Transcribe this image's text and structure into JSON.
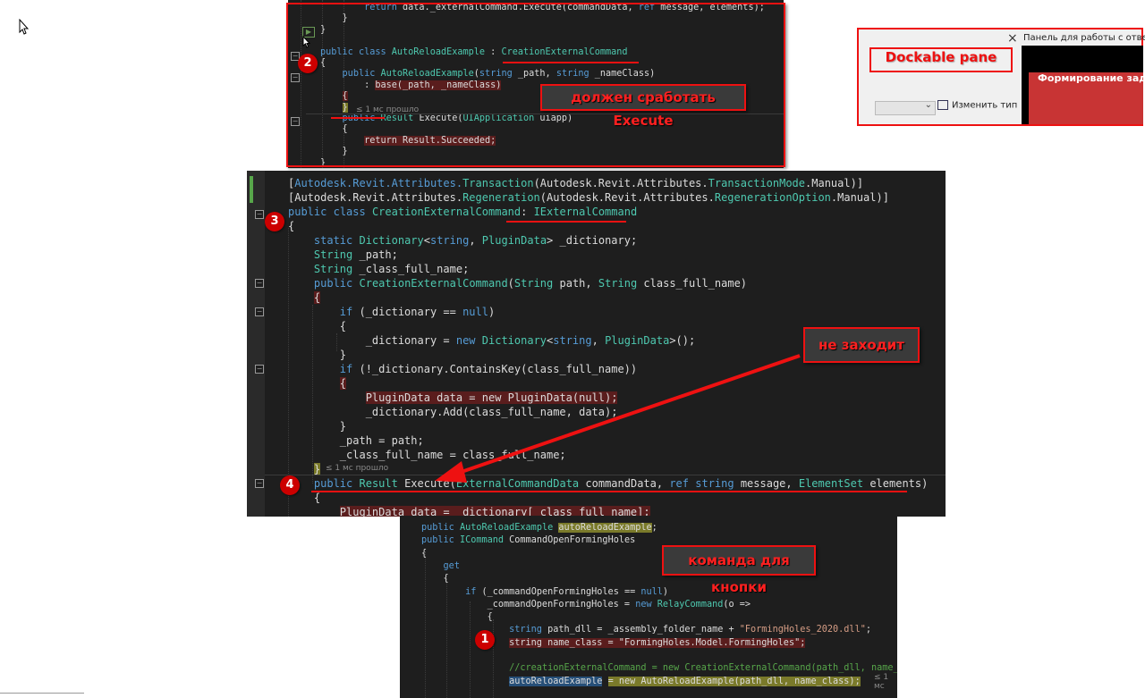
{
  "panel1": {
    "lines": [
      {
        "segs": [
          {
            "t": "        "
          },
          {
            "t": "return",
            "c": "kw"
          },
          {
            "t": " data._externalCommand.Execute(commandData, "
          },
          {
            "t": "ref",
            "c": "kw"
          },
          {
            "t": " message, elements);"
          }
        ]
      },
      {
        "segs": [
          {
            "t": "    }"
          }
        ]
      },
      {
        "segs": [
          {
            "t": "}"
          }
        ]
      },
      {
        "segs": [
          {
            "t": ""
          }
        ]
      },
      {
        "segs": [
          {
            "t": "public",
            "c": "kw"
          },
          {
            "t": " "
          },
          {
            "t": "class",
            "c": "kw"
          },
          {
            "t": " "
          },
          {
            "t": "AutoReloadExample",
            "c": "ty"
          },
          {
            "t": " : "
          },
          {
            "t": "CreationExternalCommand",
            "c": "ty"
          }
        ]
      },
      {
        "segs": [
          {
            "t": "{"
          }
        ]
      },
      {
        "segs": [
          {
            "t": "    "
          },
          {
            "t": "public",
            "c": "kw"
          },
          {
            "t": " "
          },
          {
            "t": "AutoReloadExample",
            "c": "ty"
          },
          {
            "t": "("
          },
          {
            "t": "string",
            "c": "kw"
          },
          {
            "t": " _path, "
          },
          {
            "t": "string",
            "c": "kw"
          },
          {
            "t": " _nameClass)"
          }
        ]
      },
      {
        "segs": [
          {
            "t": "        : "
          },
          {
            "t": "base(_path, _nameClass)",
            "c": "hl"
          }
        ]
      },
      {
        "segs": [
          {
            "t": "    "
          },
          {
            "t": "{",
            "c": "hl"
          }
        ]
      },
      {
        "segs": [
          {
            "t": "    "
          },
          {
            "t": "}",
            "c": "hly"
          }
        ]
      },
      {
        "segs": [
          {
            "t": "    "
          },
          {
            "t": "public",
            "c": "kw"
          },
          {
            "t": " "
          },
          {
            "t": "Result",
            "c": "ty"
          },
          {
            "t": " Execute("
          },
          {
            "t": "UIApplication",
            "c": "ty"
          },
          {
            "t": " uiapp)"
          }
        ]
      },
      {
        "segs": [
          {
            "t": "    {"
          }
        ]
      },
      {
        "segs": [
          {
            "t": "        "
          },
          {
            "t": "return Result.Succeeded;",
            "c": "hl"
          }
        ]
      },
      {
        "segs": [
          {
            "t": "    }"
          }
        ]
      },
      {
        "segs": [
          {
            "t": "}"
          }
        ]
      }
    ],
    "hint": "≤ 1 мс прошло"
  },
  "panel2": {
    "lines": [
      {
        "segs": [
          {
            "t": "["
          },
          {
            "t": "Autodesk.Revit.Attributes.",
            "c": "kw"
          },
          {
            "t": "Transaction",
            "c": "ty"
          },
          {
            "t": "(Autodesk.Revit.Attributes."
          },
          {
            "t": "TransactionMode",
            "c": "ty"
          },
          {
            "t": ".Manual)]"
          }
        ]
      },
      {
        "segs": [
          {
            "t": "[Autodesk.Revit.Attributes."
          },
          {
            "t": "Regeneration",
            "c": "ty"
          },
          {
            "t": "(Autodesk.Revit.Attributes."
          },
          {
            "t": "RegenerationOption",
            "c": "ty"
          },
          {
            "t": ".Manual)]"
          }
        ]
      },
      {
        "segs": [
          {
            "t": "public",
            "c": "kw"
          },
          {
            "t": " "
          },
          {
            "t": "class",
            "c": "kw"
          },
          {
            "t": " "
          },
          {
            "t": "CreationExternalCommand",
            "c": "ty"
          },
          {
            "t": ": "
          },
          {
            "t": "IExternalCommand",
            "c": "ty"
          }
        ]
      },
      {
        "segs": [
          {
            "t": "{"
          }
        ]
      },
      {
        "segs": [
          {
            "t": "    "
          },
          {
            "t": "static",
            "c": "kw"
          },
          {
            "t": " "
          },
          {
            "t": "Dictionary",
            "c": "ty"
          },
          {
            "t": "<"
          },
          {
            "t": "string",
            "c": "kw"
          },
          {
            "t": ", "
          },
          {
            "t": "PluginData",
            "c": "ty"
          },
          {
            "t": "> _dictionary;"
          }
        ]
      },
      {
        "segs": [
          {
            "t": "    "
          },
          {
            "t": "String",
            "c": "ty"
          },
          {
            "t": " _path;"
          }
        ]
      },
      {
        "segs": [
          {
            "t": "    "
          },
          {
            "t": "String",
            "c": "ty"
          },
          {
            "t": " _class_full_name;"
          }
        ]
      },
      {
        "segs": [
          {
            "t": "    "
          },
          {
            "t": "public",
            "c": "kw"
          },
          {
            "t": " "
          },
          {
            "t": "CreationExternalCommand",
            "c": "ty"
          },
          {
            "t": "("
          },
          {
            "t": "String",
            "c": "ty"
          },
          {
            "t": " path, "
          },
          {
            "t": "String",
            "c": "ty"
          },
          {
            "t": " class_full_name)"
          }
        ]
      },
      {
        "segs": [
          {
            "t": "    "
          },
          {
            "t": "{",
            "c": "hl"
          }
        ]
      },
      {
        "segs": [
          {
            "t": "        "
          },
          {
            "t": "if",
            "c": "kw"
          },
          {
            "t": " (_dictionary == "
          },
          {
            "t": "null",
            "c": "kw"
          },
          {
            "t": ")"
          }
        ]
      },
      {
        "segs": [
          {
            "t": "        {"
          }
        ]
      },
      {
        "segs": [
          {
            "t": "            _dictionary = "
          },
          {
            "t": "new",
            "c": "kw"
          },
          {
            "t": " "
          },
          {
            "t": "Dictionary",
            "c": "ty"
          },
          {
            "t": "<"
          },
          {
            "t": "string",
            "c": "kw"
          },
          {
            "t": ", "
          },
          {
            "t": "PluginData",
            "c": "ty"
          },
          {
            "t": ">();"
          }
        ]
      },
      {
        "segs": [
          {
            "t": "        }"
          }
        ]
      },
      {
        "segs": [
          {
            "t": "        "
          },
          {
            "t": "if",
            "c": "kw"
          },
          {
            "t": " (!_dictionary.ContainsKey(class_full_name))"
          }
        ]
      },
      {
        "segs": [
          {
            "t": "        "
          },
          {
            "t": "{",
            "c": "hl"
          }
        ]
      },
      {
        "segs": [
          {
            "t": "            "
          },
          {
            "t": "PluginData data = new PluginData(null);",
            "c": "hl"
          }
        ]
      },
      {
        "segs": [
          {
            "t": "            _dictionary.Add(class_full_name, data);"
          }
        ]
      },
      {
        "segs": [
          {
            "t": "        }"
          }
        ]
      },
      {
        "segs": [
          {
            "t": "        _path = path;"
          }
        ]
      },
      {
        "segs": [
          {
            "t": "        _class_full_name = class_full_name;"
          }
        ]
      },
      {
        "segs": [
          {
            "t": "    "
          },
          {
            "t": "}",
            "c": "hly"
          }
        ]
      },
      {
        "segs": [
          {
            "t": "    "
          },
          {
            "t": "public",
            "c": "kw"
          },
          {
            "t": " "
          },
          {
            "t": "Result",
            "c": "ty"
          },
          {
            "t": " Execute("
          },
          {
            "t": "ExternalCommandData",
            "c": "ty"
          },
          {
            "t": " commandData, "
          },
          {
            "t": "ref",
            "c": "kw"
          },
          {
            "t": " "
          },
          {
            "t": "string",
            "c": "kw"
          },
          {
            "t": " message, "
          },
          {
            "t": "ElementSet",
            "c": "ty"
          },
          {
            "t": " elements)"
          }
        ]
      },
      {
        "segs": [
          {
            "t": "    {"
          }
        ]
      },
      {
        "segs": [
          {
            "t": "        "
          },
          {
            "t": "PluginData data = _dictionary[_class_full_name];",
            "c": "hl"
          }
        ]
      }
    ],
    "hint": "≤ 1 мс прошло"
  },
  "panel3": {
    "lines": [
      {
        "segs": [
          {
            "t": "public",
            "c": "kw"
          },
          {
            "t": " "
          },
          {
            "t": "AutoReloadExample",
            "c": "ty"
          },
          {
            "t": " "
          },
          {
            "t": "autoReloadExample",
            "c": "hly"
          },
          {
            "t": ";"
          }
        ]
      },
      {
        "segs": [
          {
            "t": "public",
            "c": "kw"
          },
          {
            "t": " "
          },
          {
            "t": "ICommand",
            "c": "ty"
          },
          {
            "t": " CommandOpenFormingHoles"
          }
        ]
      },
      {
        "segs": [
          {
            "t": "{"
          }
        ]
      },
      {
        "segs": [
          {
            "t": "    "
          },
          {
            "t": "get",
            "c": "kw"
          }
        ]
      },
      {
        "segs": [
          {
            "t": "    {"
          }
        ]
      },
      {
        "segs": [
          {
            "t": "        "
          },
          {
            "t": "if",
            "c": "kw"
          },
          {
            "t": " (_commandOpenFormingHoles == "
          },
          {
            "t": "null",
            "c": "kw"
          },
          {
            "t": ")"
          }
        ]
      },
      {
        "segs": [
          {
            "t": "            _commandOpenFormingHoles = "
          },
          {
            "t": "new",
            "c": "kw"
          },
          {
            "t": " "
          },
          {
            "t": "RelayCommand",
            "c": "ty"
          },
          {
            "t": "(o =>"
          }
        ]
      },
      {
        "segs": [
          {
            "t": "            {"
          }
        ]
      },
      {
        "segs": [
          {
            "t": "                "
          },
          {
            "t": "string",
            "c": "kw"
          },
          {
            "t": " path_dll = _assembly_folder_name + "
          },
          {
            "t": "\"FormingHoles_2020.dll\"",
            "c": "st"
          },
          {
            "t": ";"
          }
        ]
      },
      {
        "segs": [
          {
            "t": "                "
          },
          {
            "t": "string name_class = \"FormingHoles.Model.FormingHoles\";",
            "c": "hl"
          }
        ]
      },
      {
        "segs": [
          {
            "t": ""
          }
        ]
      },
      {
        "segs": [
          {
            "t": "                "
          },
          {
            "t": "//creationExternalCommand = new CreationExternalCommand(path_dll, name_cl",
            "c": "cm"
          }
        ]
      },
      {
        "segs": [
          {
            "t": "                "
          },
          {
            "t": "autoReloadExample",
            "c": "hlb"
          },
          {
            "t": " "
          },
          {
            "t": "= new AutoReloadExample(path_dll, name_class);",
            "c": "hly"
          },
          {
            "t": "  "
          }
        ]
      }
    ],
    "hint": "≤ 1 мс"
  },
  "dock": {
    "title": "Панель для работы с отвер",
    "label": "Dockable pane",
    "button": "Формирование зада",
    "change_type": "Изменить тип",
    "close": "×"
  },
  "callouts": {
    "c1": "должен сработать Execute",
    "c2": "не заходит",
    "c3": "команда для кнопки"
  },
  "badges": [
    "2",
    "3",
    "4",
    "1"
  ],
  "colors": {
    "accent_red": "#e11111",
    "code_bg": "#1e1e1e",
    "keyword": "#569cd6",
    "type": "#4ec9b0"
  }
}
